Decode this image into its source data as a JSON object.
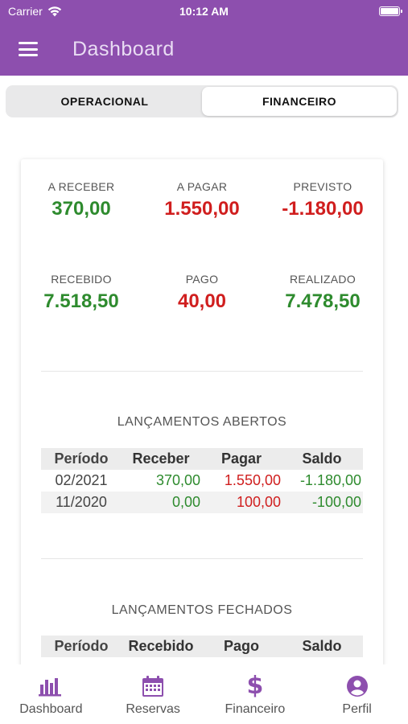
{
  "status": {
    "carrier": "Carrier",
    "time": "10:12 AM"
  },
  "app": {
    "title": "Dashboard",
    "accent": "#8d4fae"
  },
  "tabs": [
    {
      "label": "OPERACIONAL",
      "active": false
    },
    {
      "label": "FINANCEIRO",
      "active": true
    }
  ],
  "summary": {
    "a_receber": {
      "label": "A RECEBER",
      "value": "370,00",
      "color": "#2e8b2e"
    },
    "a_pagar": {
      "label": "A PAGAR",
      "value": "1.550,00",
      "color": "#d01e1e"
    },
    "previsto": {
      "label": "PREVISTO",
      "value": "-1.180,00",
      "color": "#d01e1e"
    },
    "recebido": {
      "label": "RECEBIDO",
      "value": "7.518,50",
      "color": "#2e8b2e"
    },
    "pago": {
      "label": "PAGO",
      "value": "40,00",
      "color": "#d01e1e"
    },
    "realizado": {
      "label": "REALIZADO",
      "value": "7.478,50",
      "color": "#2e8b2e"
    }
  },
  "abertos": {
    "title": "LANÇAMENTOS ABERTOS",
    "headers": [
      "Período",
      "Receber",
      "Pagar",
      "Saldo"
    ],
    "rows": [
      {
        "periodo": "02/2021",
        "receber": "370,00",
        "pagar": "1.550,00",
        "saldo": "-1.180,00"
      },
      {
        "periodo": "11/2020",
        "receber": "0,00",
        "pagar": "100,00",
        "saldo": "-100,00"
      }
    ]
  },
  "fechados": {
    "title": "LANÇAMENTOS FECHADOS",
    "headers": [
      "Período",
      "Recebido",
      "Pago",
      "Saldo"
    ]
  },
  "bottom_nav": [
    {
      "label": "Dashboard",
      "icon": "bar-chart-icon"
    },
    {
      "label": "Reservas",
      "icon": "calendar-icon"
    },
    {
      "label": "Financeiro",
      "icon": "dollar-icon"
    },
    {
      "label": "Perfil",
      "icon": "user-icon"
    }
  ]
}
